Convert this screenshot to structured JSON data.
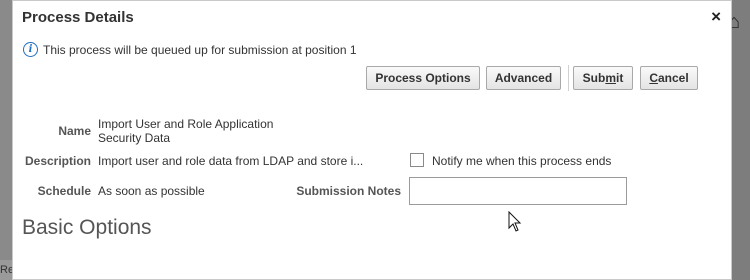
{
  "background": {
    "left_tab_text": "Re"
  },
  "dialog": {
    "title": "Process Details",
    "close_symbol": "×",
    "info_message": "This process will be queued up for submission at position 1"
  },
  "toolbar": {
    "process_options": "Process Options",
    "advanced": "Advanced",
    "submit_pre": "Sub",
    "submit_mn": "m",
    "submit_post": "it",
    "cancel_mn": "C",
    "cancel_post": "ancel"
  },
  "fields": {
    "name_label": "Name",
    "name_value_line1": "Import User and Role Application",
    "name_value_line2": "Security Data",
    "description_label": "Description",
    "description_value": "Import user and role data from LDAP and store i...",
    "schedule_label": "Schedule",
    "schedule_value": "As soon as possible",
    "notify_label": "Notify me when this process ends",
    "notify_checked": false,
    "submission_notes_label": "Submission Notes",
    "submission_notes_value": ""
  },
  "section_title": "Basic Options",
  "colors": {
    "info_icon": "#1e6fbf",
    "dialog_bg": "#ffffff",
    "backdrop": "#8a8a8a"
  }
}
